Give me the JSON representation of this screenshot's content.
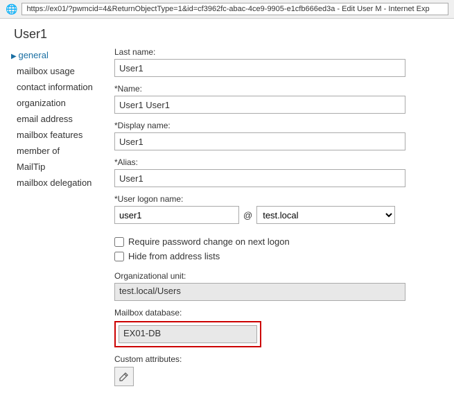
{
  "browser": {
    "url": "https://ex01/?pwmcid=4&ReturnObjectType=1&id=cf3962fc-abac-4ce9-9905-e1cfb666ed3a - Edit User M - Internet Exp"
  },
  "page": {
    "title": "User1"
  },
  "sidebar": {
    "items": [
      {
        "id": "general",
        "label": "general",
        "active": true
      },
      {
        "id": "mailbox-usage",
        "label": "mailbox usage",
        "active": false
      },
      {
        "id": "contact-information",
        "label": "contact information",
        "active": false
      },
      {
        "id": "organization",
        "label": "organization",
        "active": false
      },
      {
        "id": "email-address",
        "label": "email address",
        "active": false
      },
      {
        "id": "mailbox-features",
        "label": "mailbox features",
        "active": false
      },
      {
        "id": "member-of",
        "label": "member of",
        "active": false
      },
      {
        "id": "mailtip",
        "label": "MailTip",
        "active": false
      },
      {
        "id": "mailbox-delegation",
        "label": "mailbox delegation",
        "active": false
      }
    ]
  },
  "form": {
    "last_name_label": "Last name:",
    "last_name_value": "User1",
    "name_label": "*Name:",
    "name_value": "User1 User1",
    "display_name_label": "*Display name:",
    "display_name_value": "User1",
    "alias_label": "*Alias:",
    "alias_value": "User1",
    "logon_name_label": "*User logon name:",
    "logon_username": "user1",
    "at_sign": "@",
    "domain_value": "test.local",
    "domain_options": [
      "test.local"
    ],
    "require_password_label": "Require password change on next logon",
    "hide_address_label": "Hide from address lists",
    "org_unit_label": "Organizational unit:",
    "org_unit_value": "test.local/Users",
    "mailbox_db_label": "Mailbox database:",
    "mailbox_db_value": "EX01-DB",
    "custom_attributes_label": "Custom attributes:",
    "edit_icon": "✏"
  }
}
